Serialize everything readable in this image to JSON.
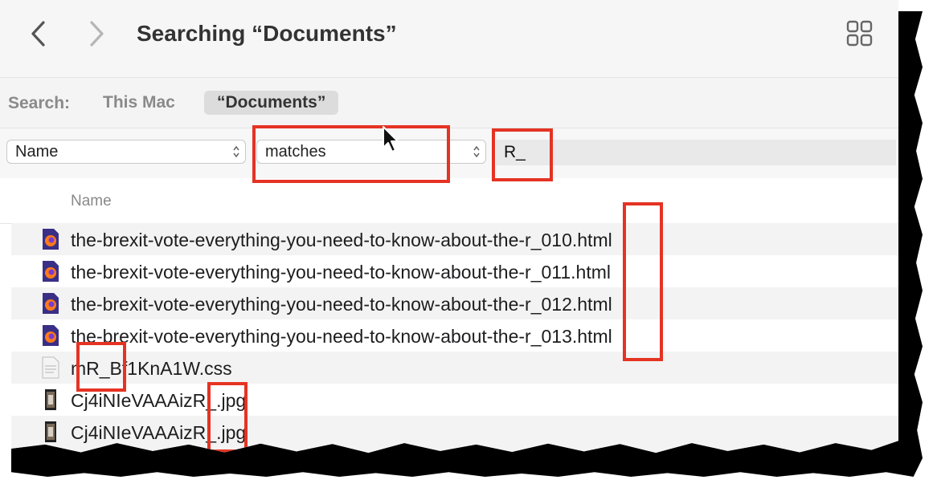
{
  "toolbar": {
    "back_icon": "chevron-left-icon",
    "forward_icon": "chevron-right-icon",
    "title": "Searching “Documents”",
    "view_icon": "grid-view-icon"
  },
  "scope": {
    "label": "Search:",
    "this_mac": "This Mac",
    "documents": "“Documents”"
  },
  "criteria": {
    "attribute": "Name",
    "operator": "matches",
    "value": "R_"
  },
  "columns": {
    "name": "Name"
  },
  "files": [
    {
      "name": "the-brexit-vote-everything-you-need-to-know-about-the-r_010.html",
      "icon": "firefox-html-icon"
    },
    {
      "name": "the-brexit-vote-everything-you-need-to-know-about-the-r_011.html",
      "icon": "firefox-html-icon"
    },
    {
      "name": "the-brexit-vote-everything-you-need-to-know-about-the-r_012.html",
      "icon": "firefox-html-icon"
    },
    {
      "name": "the-brexit-vote-everything-you-need-to-know-about-the-r_013.html",
      "icon": "firefox-html-icon"
    },
    {
      "name": "mR_Bf1KnA1W.css",
      "icon": "css-document-icon"
    },
    {
      "name": "Cj4iNIeVAAAizR_.jpg",
      "icon": "jpg-thumbnail-icon"
    },
    {
      "name": "Cj4iNIeVAAAizR_.jpg",
      "icon": "jpg-thumbnail-icon"
    }
  ],
  "colors": {
    "highlight": "#e53323",
    "row_stripe": "#f3f3f3"
  }
}
